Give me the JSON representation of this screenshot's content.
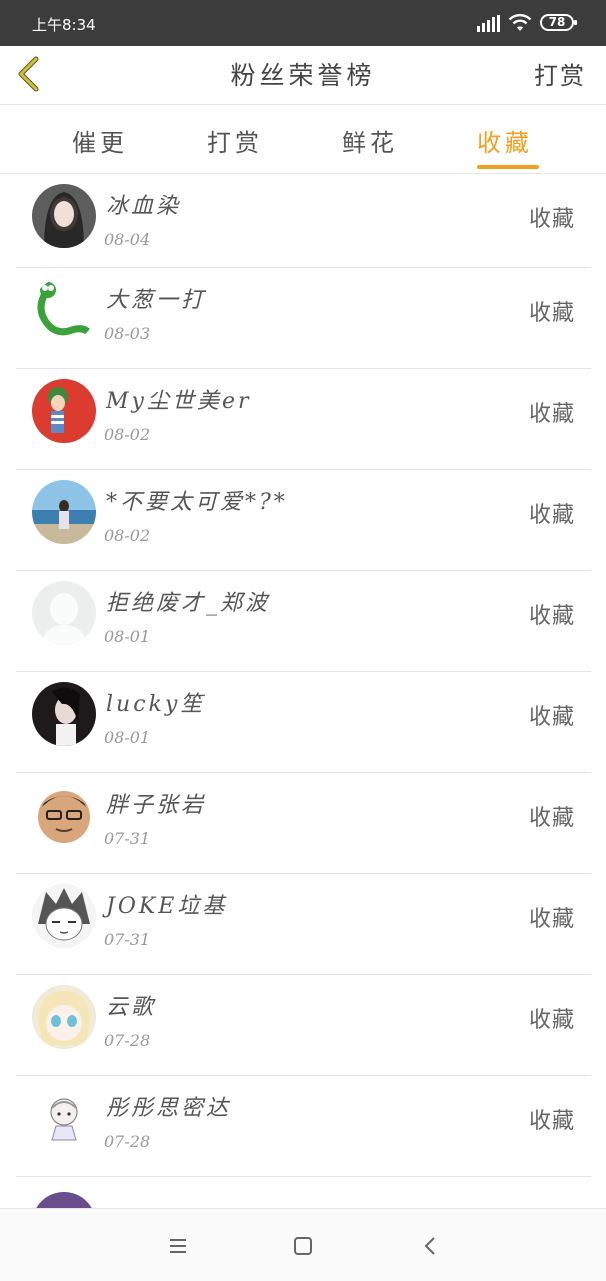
{
  "status_bar": {
    "time": "上午8:34",
    "battery": "78",
    "icons": [
      "signal-icon",
      "wifi-icon",
      "battery-icon"
    ]
  },
  "header": {
    "title": "粉丝荣誉榜",
    "action_label": "打赏",
    "back_icon": "chevron-left-icon"
  },
  "colors": {
    "accent": "#f0a01e",
    "back_icon": "#d4bf3a",
    "status_bar_bg": "#3c3c3c"
  },
  "tabs": [
    {
      "label": "催更",
      "active": false
    },
    {
      "label": "打赏",
      "active": false
    },
    {
      "label": "鲜花",
      "active": false
    },
    {
      "label": "收藏",
      "active": true
    }
  ],
  "fans": [
    {
      "name": "冰血染",
      "date": "08-04",
      "action": "收藏"
    },
    {
      "name": "大葱一打",
      "date": "08-03",
      "action": "收藏"
    },
    {
      "name": "My尘世美er",
      "date": "08-02",
      "action": "收藏"
    },
    {
      "name": "*不要太可爱*?*",
      "date": "08-02",
      "action": "收藏"
    },
    {
      "name": "拒绝废才_郑波",
      "date": "08-01",
      "action": "收藏"
    },
    {
      "name": "lucky笙",
      "date": "08-01",
      "action": "收藏"
    },
    {
      "name": "胖子张岩",
      "date": "07-31",
      "action": "收藏"
    },
    {
      "name": "JOKE垃基",
      "date": "07-31",
      "action": "收藏"
    },
    {
      "name": "云歌",
      "date": "07-28",
      "action": "收藏"
    },
    {
      "name": "彤彤思密达",
      "date": "07-28",
      "action": "收藏"
    }
  ],
  "nav_bar": {
    "icons": [
      "menu-icon",
      "home-icon",
      "back-icon"
    ]
  }
}
